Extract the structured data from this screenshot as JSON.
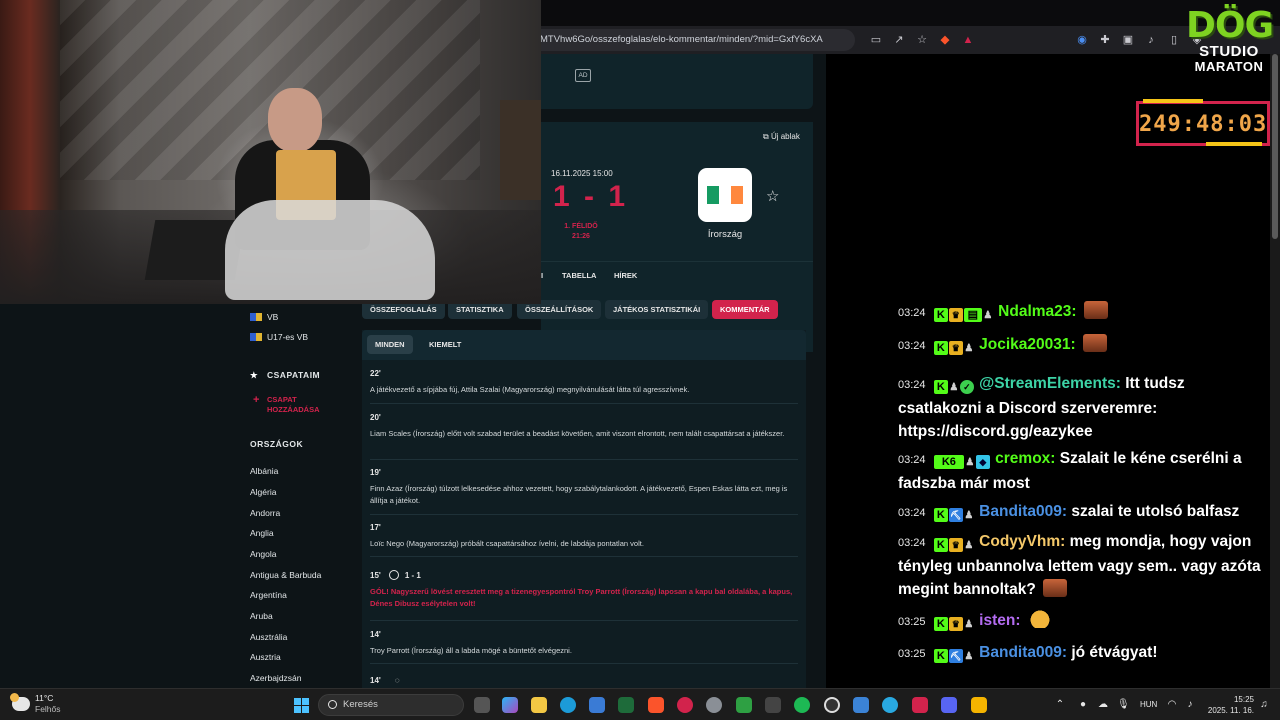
{
  "browser": {
    "url": "MTVhw6Go/osszefoglalas/elo-kommentar/minden/?mid=GxfY6cXA"
  },
  "site": {
    "ad_label": "AD",
    "new_window": "Új ablak",
    "match": {
      "date": "16.11.2025 15:00",
      "score": "1 - 1",
      "period_line1": "1. FÉLIDŐ",
      "period_line2": "21:26",
      "away_team": "Írország"
    },
    "match_tabs": [
      "I",
      "TABELLA",
      "HÍREK"
    ],
    "sub_tabs": [
      "ÖSSZEFOGLALÁS",
      "STATISZTIKA",
      "ÖSSZEÁLLÍTÁSOK",
      "JÁTÉKOS STATISZTIKÁI",
      "KOMMENTÁR"
    ],
    "filter_tabs": [
      "MINDEN",
      "KIEMELT"
    ],
    "sidebar": {
      "competitions": [
        "VB",
        "U17-es VB"
      ],
      "my_teams": "CSAPATAIM",
      "add_team_line1": "CSAPAT",
      "add_team_line2": "HOZZÁADÁSA",
      "countries_header": "ORSZÁGOK",
      "countries": [
        "Albánia",
        "Algéria",
        "Andorra",
        "Anglia",
        "Angola",
        "Antigua & Barbuda",
        "Argentína",
        "Aruba",
        "Ausztrália",
        "Ausztria",
        "Azerbajdzsán"
      ]
    },
    "commentary": [
      {
        "minute": "22'",
        "text": "A játékvezető a sípjába fúj, Attila Szalai (Magyarország) megnyilvánulását látta túl agresszívnek."
      },
      {
        "minute": "20'",
        "text": "Liam Scales (Írország) előtt volt szabad terület a beadást követően, amit viszont elrontott, nem talált csapattársat a játékszer."
      },
      {
        "minute": "19'",
        "text": "Finn Azaz (Írország) túlzott lelkesedése ahhoz vezetett, hogy szabálytalankodott. A játékvezető, Espen Eskas látta ezt, meg is állítja a játékot."
      },
      {
        "minute": "17'",
        "text": "Loïc Nego (Magyarország) próbált csapattársához ívelni, de labdája pontatlan volt."
      },
      {
        "minute": "15'",
        "score": "1 - 1",
        "text": "GÓL! Nagyszerű lövést eresztett meg a tizenegyespontról Troy Parrott (Írország) laposan a kapu bal oldalába, a kapus, Dénes Dibusz esélytelen volt!"
      },
      {
        "minute": "14'",
        "text": "Troy Parrott (Írország) áll a labda mögé a büntetőt elvégezni."
      },
      {
        "minute": "14'"
      }
    ]
  },
  "chat": {
    "messages": [
      {
        "time": "03:24",
        "user": "Ndalma23:",
        "text": "",
        "color": "#53fc18"
      },
      {
        "time": "03:24",
        "user": "Jocika20031:",
        "text": "",
        "color": "#53fc18"
      },
      {
        "time": "03:24",
        "user": "@StreamElements:",
        "text": "Itt tudsz csatlakozni a Discord szerveremre: https://discord.gg/eazykee",
        "color": "#3dd3a6"
      },
      {
        "time": "03:24",
        "user": "cremox:",
        "text": "Szalait le kéne cserélni a fadszba már most",
        "color": "#53fc18"
      },
      {
        "time": "03:24",
        "user": "Bandita009:",
        "text": "szalai te utolsó balfasz",
        "color": "#4a90e2"
      },
      {
        "time": "03:24",
        "user": "CodyyVhm:",
        "text": "meg mondja, hogy vajon tényleg unbannolva lettem vagy sem.. vagy azóta megint bannoltak?",
        "color": "#f5c96a"
      },
      {
        "time": "03:25",
        "user": "isten:",
        "text": "",
        "color": "#b36cf0"
      },
      {
        "time": "03:25",
        "user": "Bandita009:",
        "text": "jó étvágyat!",
        "color": "#4a90e2"
      }
    ]
  },
  "overlay": {
    "logo_line1": "DÖG",
    "logo_line2": "STUDIO",
    "logo_line3": "MARATON",
    "timer": "249:48:03",
    "accent": "#d2234c"
  },
  "taskbar": {
    "temperature": "11°C",
    "weather": "Felhős",
    "search_placeholder": "Keresés",
    "language": "HUN",
    "time": "15:25",
    "date": "2025. 11. 16."
  }
}
